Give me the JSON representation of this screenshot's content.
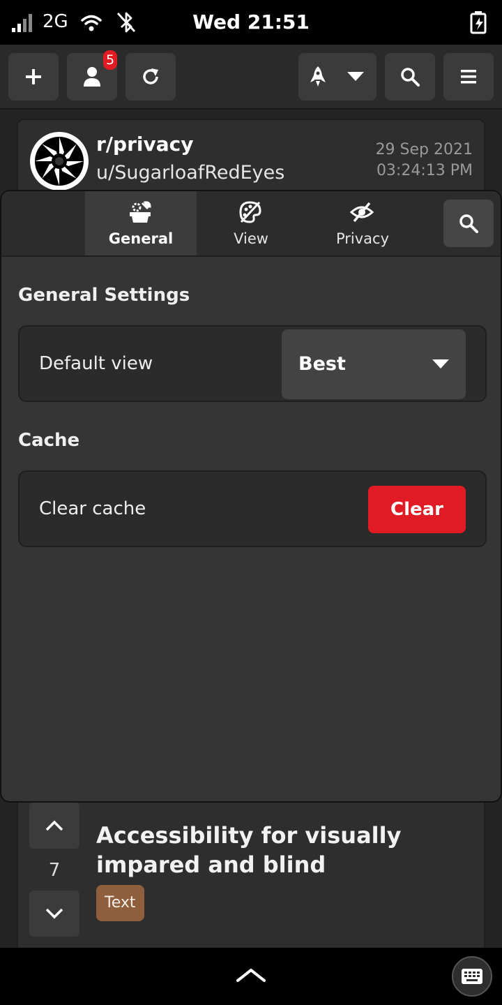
{
  "status_bar": {
    "network": "2G",
    "clock": "Wed 21:51"
  },
  "header": {
    "notification_count": "5"
  },
  "post": {
    "subreddit": "r/privacy",
    "user": "u/SugarloafRedEyes",
    "date": "29 Sep 2021",
    "time": "03:24:13 PM",
    "title": "Accessibility for visually impared and blind",
    "score": "7",
    "flair": "Text"
  },
  "settings": {
    "tabs": [
      {
        "label": "General",
        "icon": "settings-icon",
        "active": true
      },
      {
        "label": "View",
        "icon": "palette-icon",
        "active": false
      },
      {
        "label": "Privacy",
        "icon": "eye-off-icon",
        "active": false
      }
    ],
    "general_title": "General Settings",
    "default_view_label": "Default view",
    "default_view_value": "Best",
    "cache_title": "Cache",
    "clear_cache_label": "Clear cache",
    "clear_button": "Clear"
  },
  "colors": {
    "accent_red": "#e01b24",
    "flair_brown": "#8f5e3c",
    "background": "#242424"
  }
}
